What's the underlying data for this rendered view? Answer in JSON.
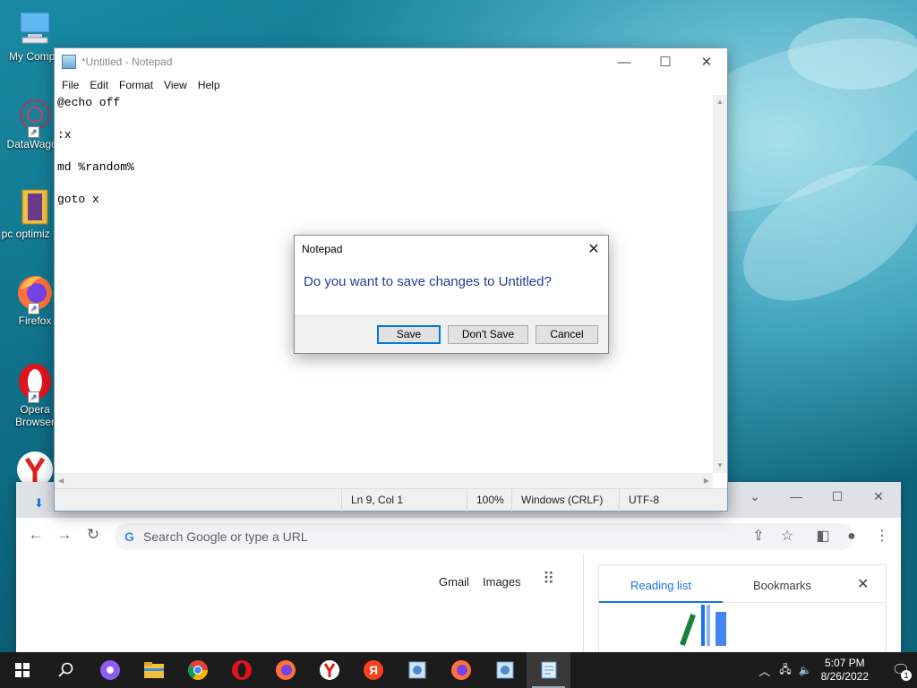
{
  "desktop": {
    "icons": [
      {
        "label": "My Compu"
      },
      {
        "label": "DataWagon"
      },
      {
        "label": "pc optimiz pro"
      },
      {
        "label": "Firefox"
      },
      {
        "label": "Opera Browser"
      }
    ]
  },
  "notepad": {
    "title": "*Untitled - Notepad",
    "menu": [
      "File",
      "Edit",
      "Format",
      "View",
      "Help"
    ],
    "content": "@echo off\n\n:x\n\nmd %random%\n\ngoto x",
    "status": {
      "position": "Ln 9, Col 1",
      "zoom": "100%",
      "line_ending": "Windows (CRLF)",
      "encoding": "UTF-8"
    }
  },
  "dialog": {
    "title": "Notepad",
    "message": "Do you want to save changes to Untitled?",
    "save": "Save",
    "dont_save": "Don't Save",
    "cancel": "Cancel"
  },
  "chrome": {
    "omnibox_placeholder": "Search Google or type a URL",
    "links": {
      "gmail": "Gmail",
      "images": "Images"
    },
    "side_panel": {
      "reading_list": "Reading list",
      "bookmarks": "Bookmarks"
    }
  },
  "taskbar": {
    "time": "5:07 PM",
    "date": "8/26/2022",
    "notification_count": "1"
  },
  "colors": {
    "accent": "#0078d7",
    "dialog_text": "#1f3f8f",
    "chrome_blue": "#1a73e8"
  }
}
